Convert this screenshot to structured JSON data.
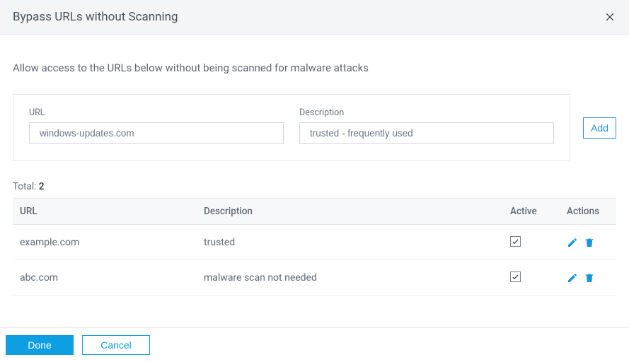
{
  "header": {
    "title": "Bypass URLs without Scanning"
  },
  "help_text": "Allow access to the URLs below without being scanned for malware attacks",
  "form": {
    "url_label": "URL",
    "url_value": "windows-updates.com",
    "desc_label": "Description",
    "desc_value": "trusted - frequently used",
    "add_label": "Add"
  },
  "total": {
    "prefix": "Total: ",
    "count": "2"
  },
  "columns": {
    "url": "URL",
    "description": "Description",
    "active": "Active",
    "actions": "Actions"
  },
  "rows": [
    {
      "url": "example.com",
      "description": "trusted",
      "active": true
    },
    {
      "url": "abc.com",
      "description": "malware scan not needed",
      "active": true
    }
  ],
  "footer": {
    "done": "Done",
    "cancel": "Cancel"
  }
}
